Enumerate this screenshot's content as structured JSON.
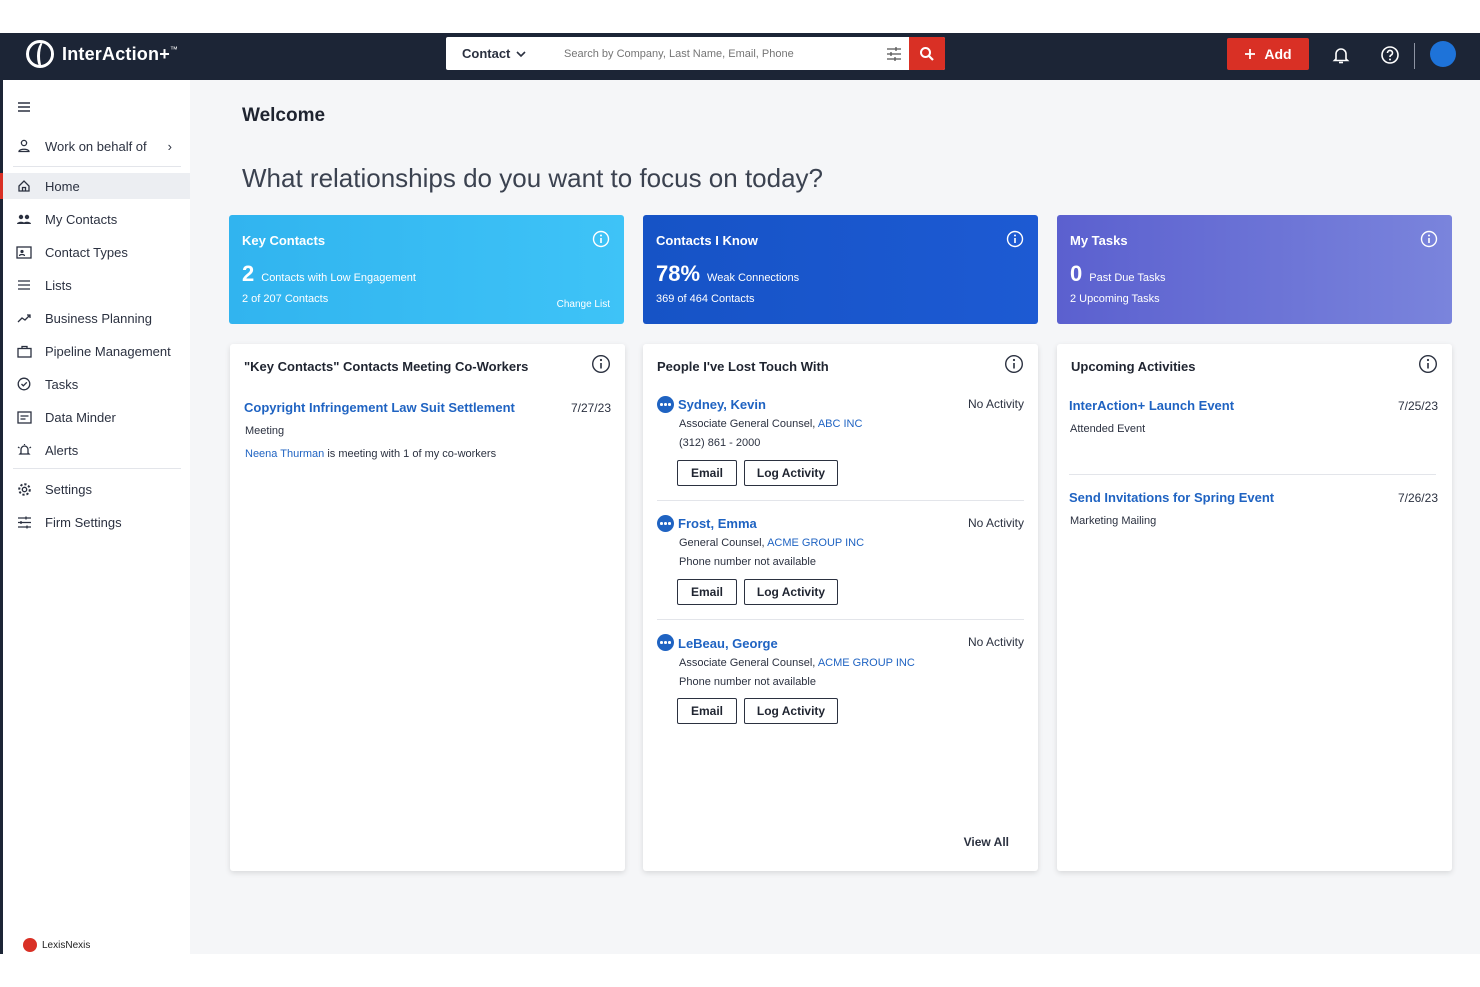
{
  "app": {
    "name": "InterAction+",
    "trademark": "™"
  },
  "search": {
    "type": "Contact",
    "placeholder": "Search by Company, Last Name, Email, Phone"
  },
  "header": {
    "add_label": "Add"
  },
  "sidebar": {
    "work_on_behalf": "Work on behalf of",
    "items": [
      {
        "label": "Home",
        "icon": "home-icon"
      },
      {
        "label": "My Contacts",
        "icon": "contacts-icon"
      },
      {
        "label": "Contact Types",
        "icon": "contact-card-icon"
      },
      {
        "label": "Lists",
        "icon": "list-icon"
      },
      {
        "label": "Business Planning",
        "icon": "trend-icon"
      },
      {
        "label": "Pipeline Management",
        "icon": "briefcase-icon"
      },
      {
        "label": "Tasks",
        "icon": "check-circle-icon"
      },
      {
        "label": "Data Minder",
        "icon": "data-icon"
      },
      {
        "label": "Alerts",
        "icon": "alert-icon"
      }
    ],
    "settings": [
      {
        "label": "Settings",
        "icon": "gear-icon"
      },
      {
        "label": "Firm Settings",
        "icon": "sliders-icon"
      }
    ],
    "footer": "LexisNexis"
  },
  "main": {
    "welcome": "Welcome",
    "prompt": "What relationships do you want to focus on today?"
  },
  "kpis": {
    "key_contacts": {
      "title": "Key Contacts",
      "value": "2",
      "label": "Contacts with Low Engagement",
      "sub": "2 of 207 Contacts",
      "link": "Change List"
    },
    "contacts_i_know": {
      "title": "Contacts I Know",
      "value": "78%",
      "label": "Weak Connections",
      "sub": "369 of 464 Contacts"
    },
    "my_tasks": {
      "title": "My Tasks",
      "value": "0",
      "label": "Past Due Tasks",
      "sub": "2 Upcoming Tasks"
    }
  },
  "coworkers": {
    "title": "\"Key Contacts\" Contacts Meeting Co-Workers",
    "item": {
      "title": "Copyright Infringement Law Suit Settlement",
      "date": "7/27/23",
      "type": "Meeting",
      "person": "Neena Thurman",
      "note": " is meeting with 1 of my co-workers"
    }
  },
  "lost_touch": {
    "title": "People I've Lost Touch With",
    "people": [
      {
        "name": "Sydney, Kevin",
        "status": "No Activity",
        "role": "Associate General Counsel, ",
        "company": "ABC INC",
        "phone": "(312) 861 - 2000"
      },
      {
        "name": "Frost, Emma",
        "status": "No Activity",
        "role": "General Counsel, ",
        "company": "ACME GROUP INC",
        "phone": "Phone number not available"
      },
      {
        "name": "LeBeau, George",
        "status": "No Activity",
        "role": "Associate General Counsel, ",
        "company": "ACME GROUP INC",
        "phone": "Phone number not available"
      }
    ],
    "email_label": "Email",
    "log_label": "Log Activity",
    "view_all": "View All"
  },
  "upcoming": {
    "title": "Upcoming Activities",
    "items": [
      {
        "title": "InterAction+ Launch Event",
        "date": "7/25/23",
        "type": "Attended Event"
      },
      {
        "title": "Send Invitations for Spring Event",
        "date": "7/26/23",
        "type": "Marketing Mailing"
      }
    ]
  },
  "colors": {
    "accent_red": "#d93025",
    "header_bg": "#1c2536",
    "link_blue": "#1f63c2"
  }
}
